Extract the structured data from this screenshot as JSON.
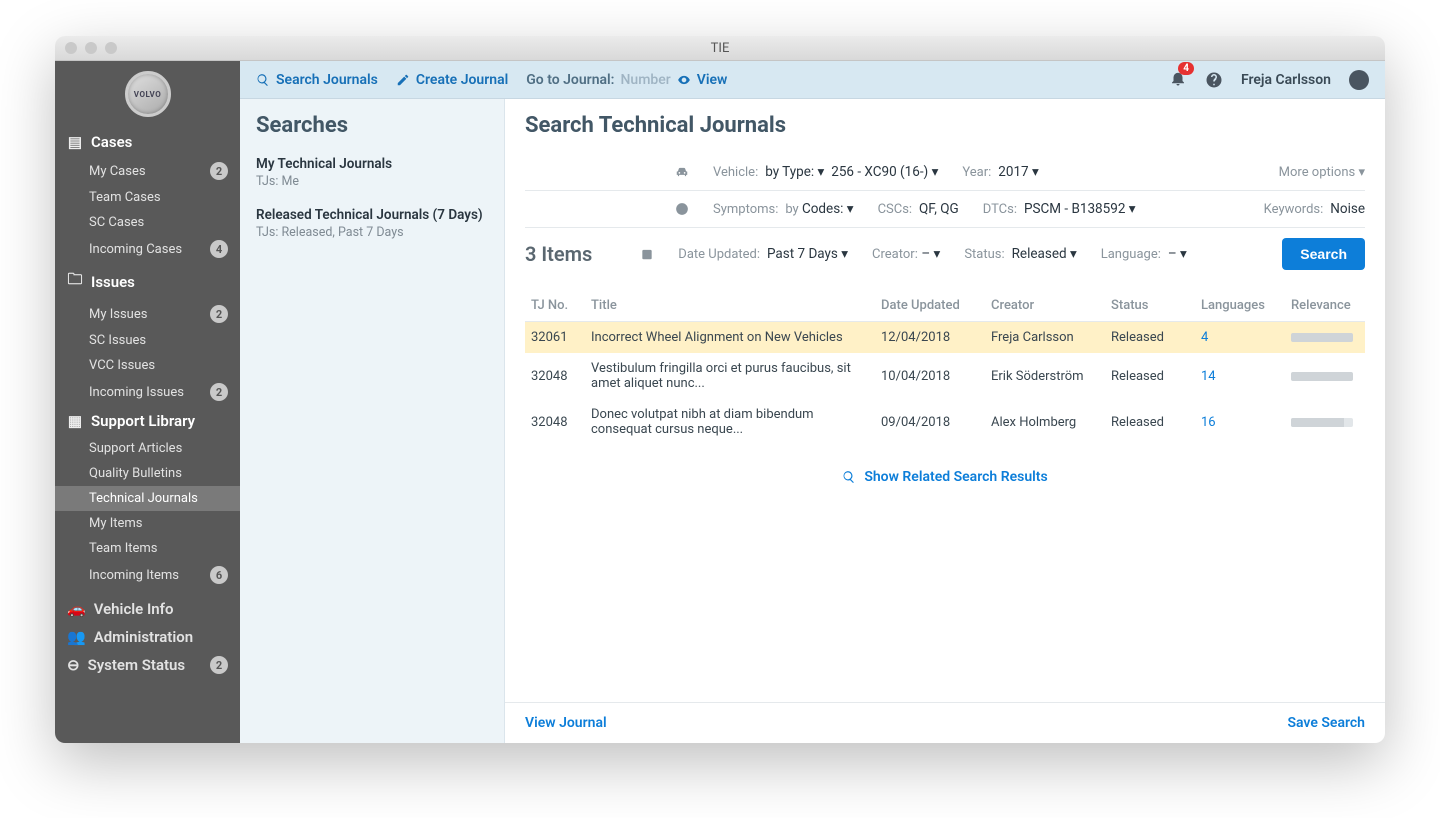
{
  "window": {
    "title": "TIE"
  },
  "logo_text": "VOLVO",
  "topbar": {
    "search_journals": "Search Journals",
    "create_journal": "Create Journal",
    "goto_label": "Go to Journal:",
    "goto_placeholder": "Number",
    "view": "View",
    "notifications_count": "4",
    "username": "Freja Carlsson"
  },
  "sidebar": {
    "sections": [
      {
        "label": "Cases",
        "icon": "file",
        "items": [
          {
            "label": "My Cases",
            "badge": "2"
          },
          {
            "label": "Team Cases"
          },
          {
            "label": "SC Cases"
          },
          {
            "label": "Incoming Cases",
            "badge": "4"
          }
        ]
      },
      {
        "label": "Issues",
        "icon": "folder",
        "items": [
          {
            "label": "My Issues",
            "badge": "2"
          },
          {
            "label": "SC Issues"
          },
          {
            "label": "VCC Issues"
          },
          {
            "label": "Incoming Issues",
            "badge": "2"
          }
        ]
      },
      {
        "label": "Support Library",
        "icon": "book",
        "items": [
          {
            "label": "Support Articles"
          },
          {
            "label": "Quality Bulletins"
          },
          {
            "label": "Technical Journals",
            "active": true
          },
          {
            "label": "My Items"
          },
          {
            "label": "Team Items"
          },
          {
            "label": "Incoming Items",
            "badge": "6"
          }
        ]
      }
    ],
    "simple": [
      {
        "label": "Vehicle Info",
        "icon": "car"
      },
      {
        "label": "Administration",
        "icon": "users"
      },
      {
        "label": "System Status",
        "icon": "minus",
        "badge": "2"
      }
    ]
  },
  "searches": {
    "title": "Searches",
    "items": [
      {
        "title": "My Technical Journals",
        "subtitle": "TJs: Me"
      },
      {
        "title": "Released Technical Journals (7 Days)",
        "subtitle": "TJs: Released, Past 7 Days"
      }
    ]
  },
  "results": {
    "title": "Search Technical Journals",
    "count_label": "3 Items",
    "filters": {
      "vehicle_label": "Vehicle:",
      "vehicle_by_type": "by Type: ▾",
      "vehicle_val": "256 - XC90 (16-) ▾",
      "year_label": "Year:",
      "year_val": "2017 ▾",
      "more_options": "More options  ▾",
      "symptoms_label": "Symptoms:",
      "symptoms_by": "by ",
      "symptoms_by_codes": "Codes: ▾",
      "cscs_label": "CSCs:",
      "cscs_val": "QF, QG",
      "dtcs_label": "DTCs:",
      "dtcs_val": "PSCM - B138592 ▾",
      "keywords_label": "Keywords:",
      "keywords_val": "Noise",
      "date_label": "Date Updated:",
      "date_val": "Past 7 Days ▾",
      "creator_label": "Creator:",
      "creator_val": "–  ▾",
      "status_label": "Status:",
      "status_val": "Released ▾",
      "language_label": "Language:",
      "language_val": "– ▾",
      "search_btn": "Search"
    }
  },
  "table": {
    "headers": [
      "TJ No.",
      "Title",
      "Date Updated",
      "Creator",
      "Status",
      "Languages",
      "Relevance"
    ],
    "rows": [
      {
        "tj": "32061",
        "title": "Incorrect Wheel Alignment on New Vehicles",
        "date": "12/04/2018",
        "creator": "Freja Carlsson",
        "status": "Released",
        "langs": "4",
        "rel": 100,
        "hl": true
      },
      {
        "tj": "32048",
        "title": "Vestibulum fringilla orci et purus faucibus, sit amet aliquet nunc...",
        "date": "10/04/2018",
        "creator": "Erik Söderström",
        "status": "Released",
        "langs": "14",
        "rel": 100
      },
      {
        "tj": "32048",
        "title": "Donec volutpat nibh at diam bibendum consequat cursus neque...",
        "date": "09/04/2018",
        "creator": "Alex Holmberg",
        "status": "Released",
        "langs": "16",
        "rel": 85
      }
    ]
  },
  "related": "Show Related Search Results",
  "footer": {
    "view_journal": "View Journal",
    "save_search": "Save Search"
  }
}
